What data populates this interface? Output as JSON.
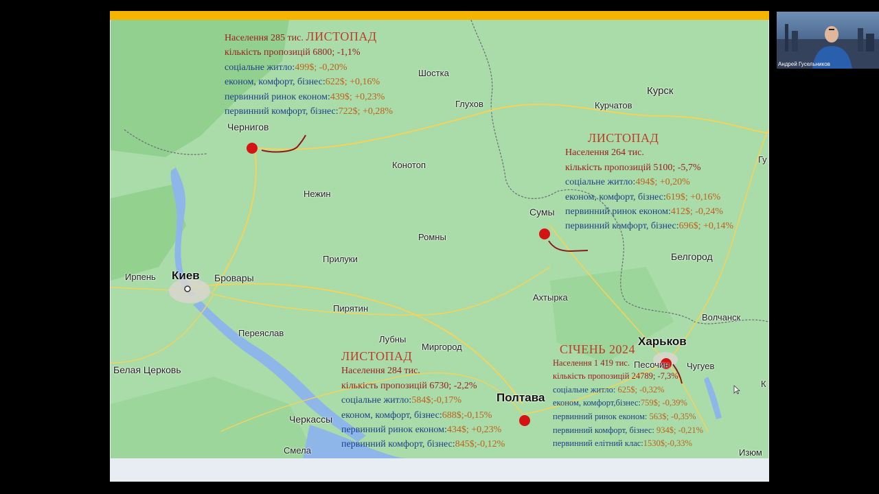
{
  "cities": {
    "shostka": "Шостка",
    "kursk": "Курск",
    "glukhov": "Глухов",
    "kurchatov": "Курчатов",
    "chernigov": "Чернигов",
    "konotop": "Конотоп",
    "gu": "Гу",
    "nezhin": "Нежин",
    "sumy": "Сумы",
    "romny": "Ромны",
    "belgorod": "Белгород",
    "priluki": "Прилуки",
    "irpen": "Ирпень",
    "kiev": "Киев",
    "brovary": "Бровары",
    "akhtyrka": "Ахтырка",
    "piryatin": "Пирятин",
    "volchansk": "Волчанск",
    "pereyaslav": "Переяслав",
    "lubny": "Лубны",
    "mirgorod": "Миргород",
    "kharkov": "Харьков",
    "pesochin": "Песочин",
    "chuguev": "Чугуев",
    "belaya_tserkov": "Белая Церковь",
    "poltava": "Полтава",
    "cherkassy": "Черкассы",
    "smela": "Смела",
    "izyum": "Изюм",
    "k_edge": "К"
  },
  "chernigov_block": {
    "population": "Населення 285 тис.",
    "month": "ЛИСТОПАД",
    "offers": "кількість пропозицій 6800; -1,1%",
    "social_label": "соціальне житло:",
    "social_value": "499$; -0,20%",
    "econ_label": "економ, комфорт, бізнес:",
    "econ_value": "622$; +0,16%",
    "prim_econ_label": "первинний ринок економ:",
    "prim_econ_value": "439$; +0,23%",
    "prim_comf_label": "первинний комфорт, бізнес:",
    "prim_comf_value": "722$; +0,28%"
  },
  "sumy_block": {
    "month": "ЛИСТОПАД",
    "population": "Населення 264 тис.",
    "offers": "кількість пропозицій 5100; -5,7%",
    "social_label": "соціальне житло:",
    "social_value": "494$; +0,20%",
    "econ_label": "економ, комфорт, бізнес:",
    "econ_value": "619$; +0,16%",
    "prim_econ_label": "первинний ринок економ:",
    "prim_econ_value": "412$; -0,24%",
    "prim_comf_label": "первинний комфорт, бізнес:",
    "prim_comf_value": "696$; +0,14%"
  },
  "poltava_block": {
    "month": "ЛИСТОПАД",
    "population": "Населення 284 тис.",
    "offers": "кількість пропозицій 6730; -2,2%",
    "social_label": "соціальне житло:",
    "social_value": "584$;-0,17%",
    "econ_label": "економ, комфорт, бізнес:",
    "econ_value": "688$;-0,15%",
    "prim_econ_label": "первинний ринок економ:",
    "prim_econ_value": "434$; +0,23%",
    "prim_comf_label": "первинний комфорт, бізнес:",
    "prim_comf_value": "845$;-0,12%"
  },
  "kharkov_block": {
    "month": "СІЧЕНЬ 2024",
    "population": "Населення 1 419 тис.",
    "offers": "кількість пропозицій 24789; -7,3%",
    "social_label": "соціальне житло:",
    "social_value": "625$; -0,32%",
    "econ_label": "економ, комфорт,бізнес:",
    "econ_value": "759$; -0,39%",
    "prim_econ_label": "первинний ринок економ:",
    "prim_econ_value": "563$; -0,35%",
    "prim_comf_label": "первинний комфорт, бізнес:",
    "prim_comf_value": "934$; -0,21%",
    "elite_label": "первинний елітний клас:",
    "elite_value": "1530$;-0,33%"
  },
  "webcam": {
    "name": "Андрей Гусельников"
  },
  "colors": {
    "accent_bar": "#f5b400",
    "marker": "#d31414",
    "month_text": "#c0392b",
    "red_text": "#9b1c1c",
    "blue_text": "#1f3f8a",
    "orange_text": "#c0601c"
  }
}
